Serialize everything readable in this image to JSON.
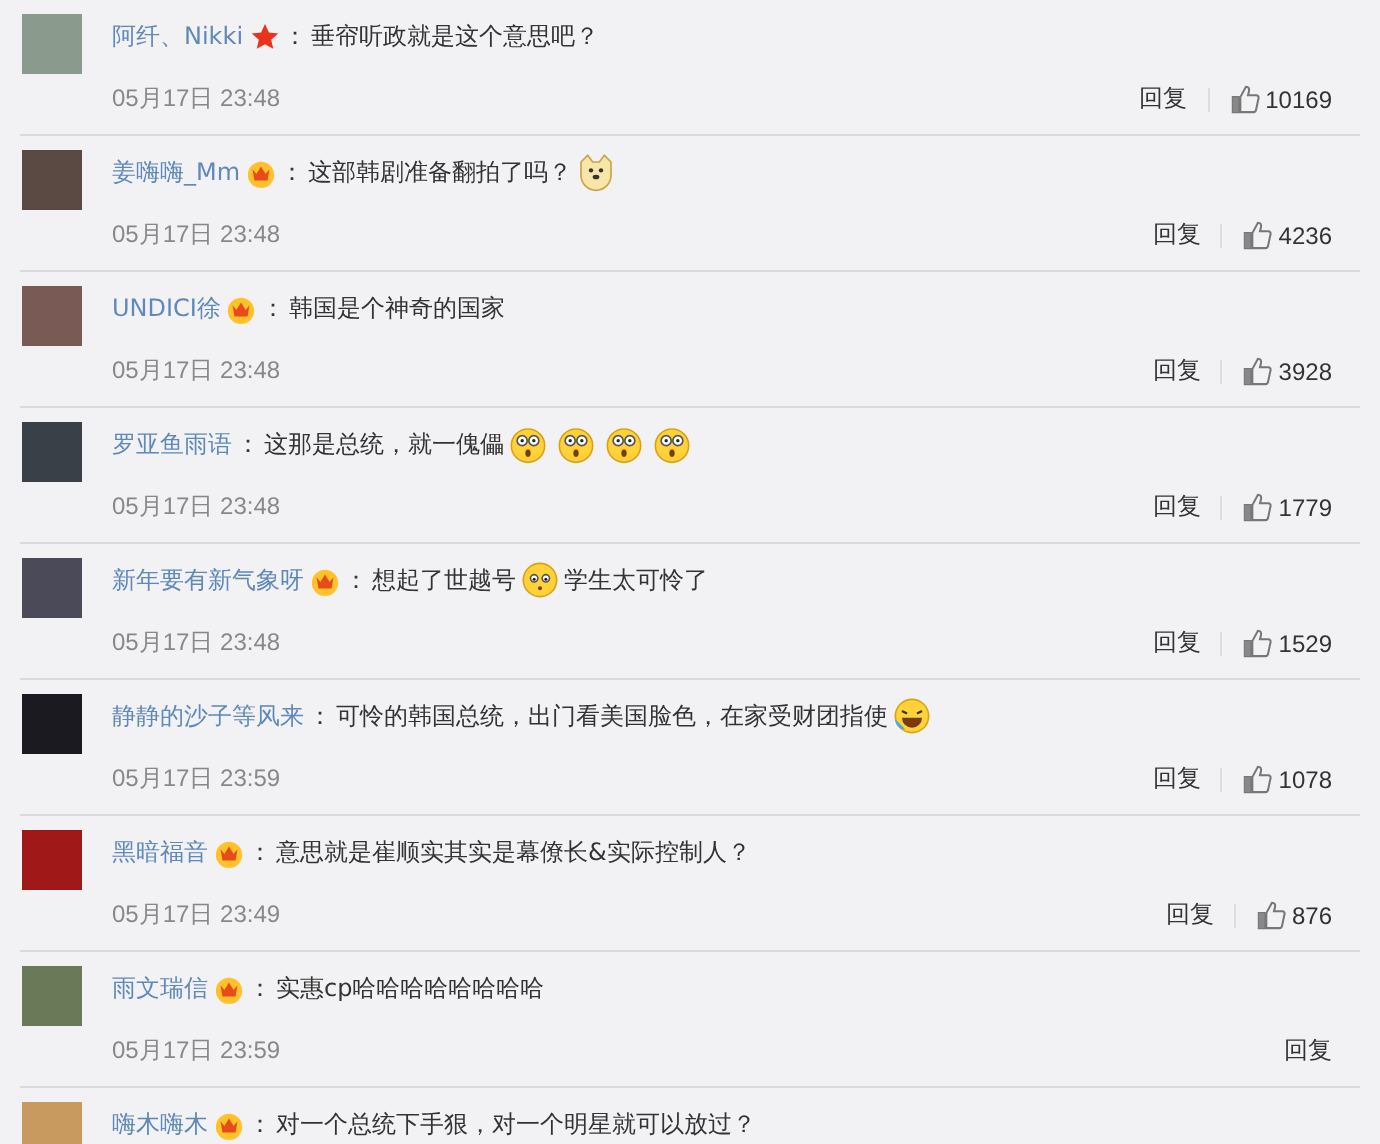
{
  "comments": [
    {
      "user": "阿纤、Nikki",
      "star_badge": true,
      "crown_badge": false,
      "colon": "：",
      "content": [
        {
          "kind": "text",
          "text": "垂帘听政就是这个意思吧？"
        }
      ],
      "time": "05月17日 23:48",
      "reply": "回复",
      "likes": "10169"
    },
    {
      "user": "姜嗨嗨_Mm",
      "star_badge": false,
      "crown_badge": true,
      "colon": "：",
      "content": [
        {
          "kind": "text",
          "text": "这部韩剧准备翻拍了吗？"
        },
        {
          "kind": "dog"
        }
      ],
      "time": "05月17日 23:48",
      "reply": "回复",
      "likes": "4236"
    },
    {
      "user": "UNDICI徐",
      "star_badge": false,
      "crown_badge": true,
      "colon": "：",
      "content": [
        {
          "kind": "text",
          "text": "韩国是个神奇的国家"
        }
      ],
      "time": "05月17日 23:48",
      "reply": "回复",
      "likes": "3928"
    },
    {
      "user": "罗亚鱼雨语",
      "star_badge": false,
      "crown_badge": false,
      "colon": "：",
      "content": [
        {
          "kind": "text",
          "text": "这那是总统，就一傀儡"
        },
        {
          "kind": "shock"
        },
        {
          "kind": "shock"
        },
        {
          "kind": "shock"
        },
        {
          "kind": "shock"
        }
      ],
      "time": "05月17日 23:48",
      "reply": "回复",
      "likes": "1779"
    },
    {
      "user": "新年要有新气象呀",
      "star_badge": false,
      "crown_badge": true,
      "colon": "：",
      "content": [
        {
          "kind": "text",
          "text": "想起了世越号"
        },
        {
          "kind": "worry"
        },
        {
          "kind": "text",
          "text": "学生太可怜了"
        }
      ],
      "time": "05月17日 23:48",
      "reply": "回复",
      "likes": "1529"
    },
    {
      "user": "静静的沙子等风来",
      "star_badge": false,
      "crown_badge": false,
      "colon": "：",
      "content": [
        {
          "kind": "text",
          "text": "可怜的韩国总统，出门看美国脸色，在家受财团指使"
        },
        {
          "kind": "laugh"
        }
      ],
      "time": "05月17日 23:59",
      "reply": "回复",
      "likes": "1078"
    },
    {
      "user": "黑暗福音",
      "star_badge": false,
      "crown_badge": true,
      "colon": "：",
      "content": [
        {
          "kind": "text",
          "text": "意思就是崔顺实其实是幕僚长&实际控制人？"
        }
      ],
      "time": "05月17日 23:49",
      "reply": "回复",
      "likes": "876"
    },
    {
      "user": "雨文瑞信",
      "star_badge": false,
      "crown_badge": true,
      "colon": "：",
      "content": [
        {
          "kind": "text",
          "text": "实惠cp哈哈哈哈哈哈哈哈"
        }
      ],
      "time": "05月17日 23:59",
      "reply": "回复"
    },
    {
      "user": "嗨木嗨木",
      "star_badge": false,
      "crown_badge": true,
      "colon": "：",
      "content": [
        {
          "kind": "text",
          "text": "对一个总统下手狠，对一个明星就可以放过？"
        }
      ]
    }
  ]
}
